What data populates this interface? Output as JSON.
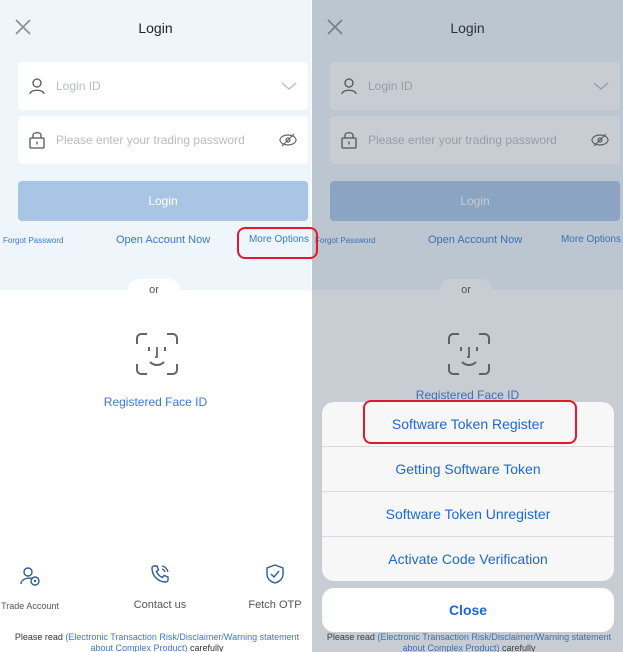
{
  "header": {
    "title": "Login",
    "close_icon": "close-icon"
  },
  "login_form": {
    "login_id_placeholder": "Login ID",
    "password_placeholder": "Please enter your trading password",
    "login_button": "Login"
  },
  "links": {
    "forgot": "Forgot Password",
    "open_account": "Open Account Now",
    "more_options": "More Options"
  },
  "divider": "or",
  "face_id": {
    "label": "Registered Face ID",
    "icon": "face-id-icon"
  },
  "bottom_nav": [
    {
      "label": "Trade Account",
      "icon": "trade-account-icon"
    },
    {
      "label": "Contact us",
      "icon": "phone-icon"
    },
    {
      "label": "Fetch OTP",
      "icon": "shield-check-icon"
    }
  ],
  "disclaimer": {
    "prefix": "Please read ",
    "link": "(Electronic Transaction Risk/Disclaimer/Warning statement about Complex Product)",
    "suffix": " carefully"
  },
  "action_sheet": {
    "items": [
      "Software Token Register",
      "Getting Software Token",
      "Software Token Unregister",
      "Activate Code Verification"
    ],
    "close": "Close"
  },
  "colors": {
    "accent": "#3a79d6",
    "button": "#a9c5e6",
    "highlight": "#e3182a",
    "background_top": "#eef5fb"
  }
}
